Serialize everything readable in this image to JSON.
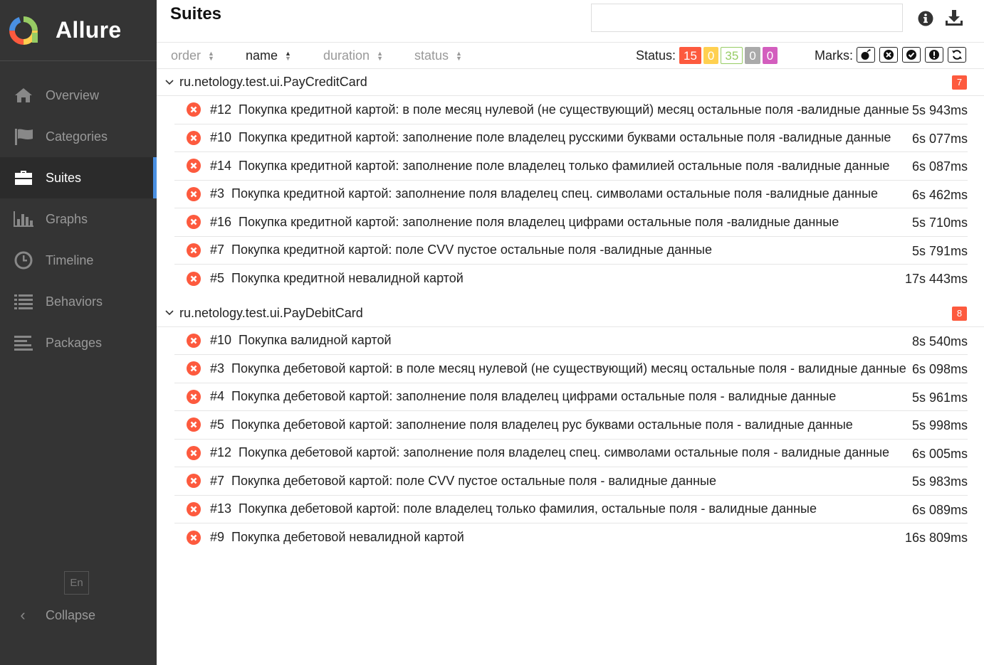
{
  "brand": {
    "name": "Allure"
  },
  "sidebar": {
    "items": [
      {
        "label": "Overview",
        "icon": "home-icon",
        "active": false
      },
      {
        "label": "Categories",
        "icon": "flag-icon",
        "active": false
      },
      {
        "label": "Suites",
        "icon": "briefcase-icon",
        "active": true
      },
      {
        "label": "Graphs",
        "icon": "bar-chart-icon",
        "active": false
      },
      {
        "label": "Timeline",
        "icon": "clock-icon",
        "active": false
      },
      {
        "label": "Behaviors",
        "icon": "list-icon",
        "active": false
      },
      {
        "label": "Packages",
        "icon": "align-left-icon",
        "active": false
      }
    ],
    "language": "En",
    "collapse_label": "Collapse"
  },
  "header": {
    "title": "Suites",
    "search_value": ""
  },
  "toolbar": {
    "sort": {
      "order": "order",
      "name": "name",
      "duration": "duration",
      "status": "status",
      "active": "name"
    },
    "status_label": "Status:",
    "status_counts": {
      "failed": "15",
      "broken": "0",
      "passed": "35",
      "skipped": "0",
      "unknown": "0"
    },
    "marks_label": "Marks:",
    "marks": [
      "flaky-icon",
      "new-failed-icon",
      "new-passed-icon",
      "new-broken-icon",
      "retries-icon"
    ]
  },
  "colors": {
    "failed": "#fd5a3e",
    "broken": "#ffd050",
    "passed": "#97cc64",
    "skipped": "#aaaaaa",
    "unknown": "#d35ebe",
    "accent": "#4a90e2",
    "sidebar_bg": "#343434"
  },
  "groups": [
    {
      "name": "ru.netology.test.ui.PayCreditCard",
      "count": "7",
      "tests": [
        {
          "num": "#12",
          "name": "Покупка кредитной картой: в поле месяц нулевой (не существующий) месяц остальные поля -валидные данные",
          "duration": "5s 943ms",
          "status": "failed"
        },
        {
          "num": "#10",
          "name": "Покупка кредитной картой: заполнение поле владелец русскими буквами остальные поля -валидные данные",
          "duration": "6s 077ms",
          "status": "failed"
        },
        {
          "num": "#14",
          "name": "Покупка кредитной картой: заполнение поле владелец только фамилией остальные поля -валидные данные",
          "duration": "6s 087ms",
          "status": "failed"
        },
        {
          "num": "#3",
          "name": "Покупка кредитной картой: заполнение поля владелец спец. символами остальные поля -валидные данные",
          "duration": "6s 462ms",
          "status": "failed"
        },
        {
          "num": "#16",
          "name": "Покупка кредитной картой: заполнение поля владелец цифрами остальные поля -валидные данные",
          "duration": "5s 710ms",
          "status": "failed"
        },
        {
          "num": "#7",
          "name": "Покупка кредитной картой: поле CVV пустое остальные поля -валидные данные",
          "duration": "5s 791ms",
          "status": "failed"
        },
        {
          "num": "#5",
          "name": "Покупка кредитной невалидной картой",
          "duration": "17s 443ms",
          "status": "failed"
        }
      ]
    },
    {
      "name": "ru.netology.test.ui.PayDebitCard",
      "count": "8",
      "tests": [
        {
          "num": "#10",
          "name": "Покупка валидной картой",
          "duration": "8s 540ms",
          "status": "failed"
        },
        {
          "num": "#3",
          "name": "Покупка дебетовой картой: в поле месяц нулевой (не существующий) месяц остальные поля - валидные данные",
          "duration": "6s 098ms",
          "status": "failed"
        },
        {
          "num": "#4",
          "name": "Покупка дебетовой картой: заполнение поля владелец цифрами остальные поля - валидные данные",
          "duration": "5s 961ms",
          "status": "failed"
        },
        {
          "num": "#5",
          "name": "Покупка дебетовой картой: заполнение поля владелец рус буквами остальные поля - валидные данные",
          "duration": "5s 998ms",
          "status": "failed"
        },
        {
          "num": "#12",
          "name": "Покупка дебетовой картой: заполнение поля владелец спец. символами остальные поля - валидные данные",
          "duration": "6s 005ms",
          "status": "failed"
        },
        {
          "num": "#7",
          "name": "Покупка дебетовой картой: поле CVV пустое остальные поля - валидные данные",
          "duration": "5s 983ms",
          "status": "failed"
        },
        {
          "num": "#13",
          "name": "Покупка дебетовой картой: поле владелец только фамилия, остальные поля - валидные данные",
          "duration": "6s 089ms",
          "status": "failed"
        },
        {
          "num": "#9",
          "name": "Покупка дебетовой невалидной картой",
          "duration": "16s 809ms",
          "status": "failed"
        }
      ]
    }
  ]
}
